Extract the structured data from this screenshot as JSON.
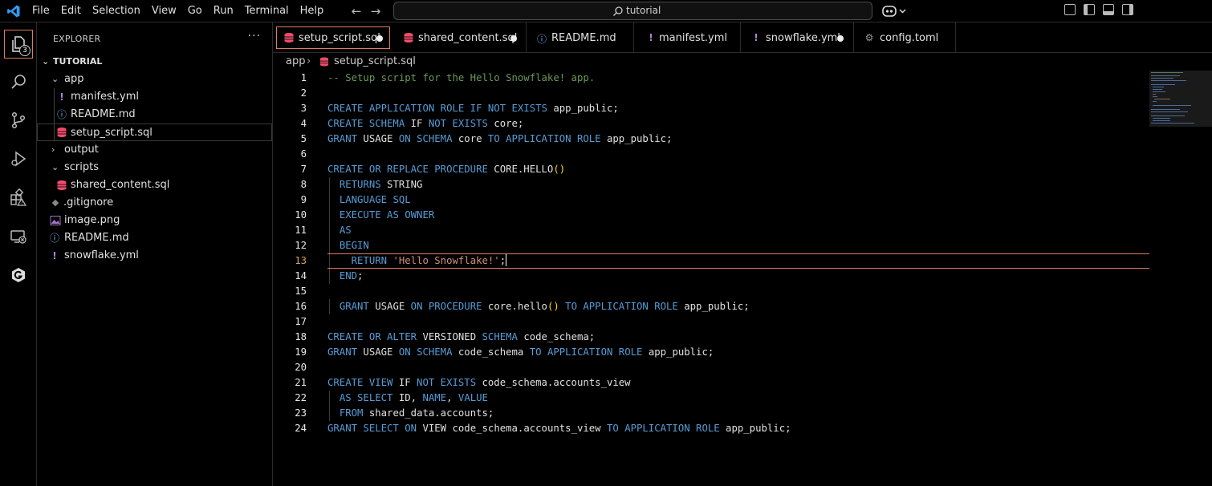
{
  "titlebar": {
    "menu": [
      "File",
      "Edit",
      "Selection",
      "View",
      "Go",
      "Run",
      "Terminal",
      "Help"
    ],
    "search_text": "tutorial"
  },
  "activity": {
    "explorer_badge": "3"
  },
  "sidebar": {
    "header": "EXPLORER",
    "more": "···",
    "root": "TUTORIAL",
    "items": [
      {
        "label": "app",
        "kind": "folder-open"
      },
      {
        "label": "manifest.yml",
        "kind": "yaml"
      },
      {
        "label": "README.md",
        "kind": "info"
      },
      {
        "label": "setup_script.sql",
        "kind": "db"
      },
      {
        "label": "output",
        "kind": "folder-closed"
      },
      {
        "label": "scripts",
        "kind": "folder-open"
      },
      {
        "label": "shared_content.sql",
        "kind": "db"
      },
      {
        "label": ".gitignore",
        "kind": "git"
      },
      {
        "label": "image.png",
        "kind": "image"
      },
      {
        "label": "README.md",
        "kind": "info"
      },
      {
        "label": "snowflake.yml",
        "kind": "yaml"
      }
    ]
  },
  "tabs": [
    {
      "label": "setup_script.sql",
      "icon": "db-icon",
      "dirty": true,
      "active": true
    },
    {
      "label": "shared_content.sql",
      "icon": "db-icon",
      "dirty": true
    },
    {
      "label": "README.md",
      "icon": "info-icon",
      "dirty": false
    },
    {
      "label": "manifest.yml",
      "icon": "yaml-icon",
      "dirty": false
    },
    {
      "label": "snowflake.yml",
      "icon": "yaml-icon",
      "dirty": true
    },
    {
      "label": "config.toml",
      "icon": "gear-icon",
      "dirty": false
    }
  ],
  "breadcrumb": {
    "folder": "app",
    "file": "setup_script.sql"
  },
  "editor": {
    "current_line": 13,
    "lines": [
      "1",
      "2",
      "3",
      "4",
      "5",
      "6",
      "7",
      "8",
      "9",
      "10",
      "11",
      "12",
      "13",
      "14",
      "15",
      "16",
      "17",
      "18",
      "19",
      "20",
      "21",
      "22",
      "23",
      "24"
    ]
  },
  "colors": {
    "keyword": "#569cd6",
    "comment": "#6a9955",
    "string": "#ce9178",
    "accent": "#e07a5f"
  }
}
